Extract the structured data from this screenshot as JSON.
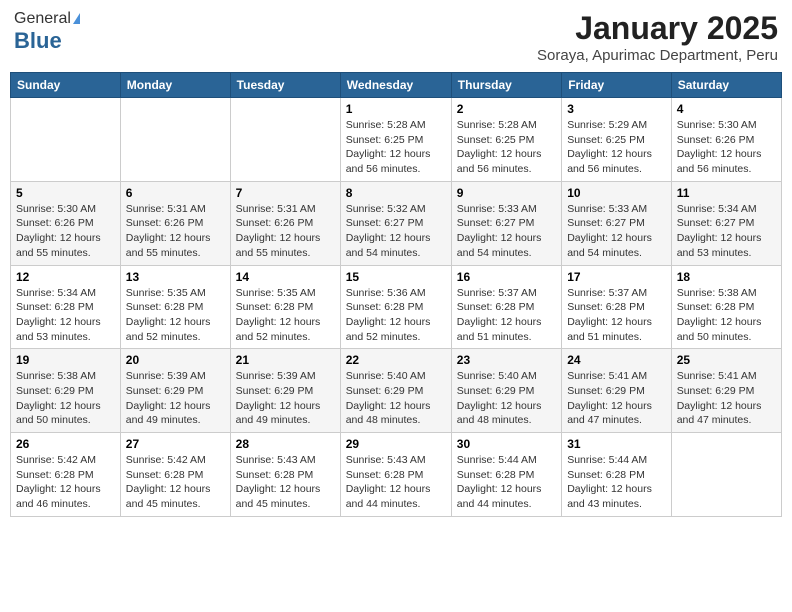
{
  "header": {
    "logo_line1": "General",
    "logo_line2": "Blue",
    "month_title": "January 2025",
    "subtitle": "Soraya, Apurimac Department, Peru"
  },
  "weekdays": [
    "Sunday",
    "Monday",
    "Tuesday",
    "Wednesday",
    "Thursday",
    "Friday",
    "Saturday"
  ],
  "weeks": [
    [
      {
        "day": "",
        "sunrise": "",
        "sunset": "",
        "daylight": ""
      },
      {
        "day": "",
        "sunrise": "",
        "sunset": "",
        "daylight": ""
      },
      {
        "day": "",
        "sunrise": "",
        "sunset": "",
        "daylight": ""
      },
      {
        "day": "1",
        "sunrise": "Sunrise: 5:28 AM",
        "sunset": "Sunset: 6:25 PM",
        "daylight": "Daylight: 12 hours and 56 minutes."
      },
      {
        "day": "2",
        "sunrise": "Sunrise: 5:28 AM",
        "sunset": "Sunset: 6:25 PM",
        "daylight": "Daylight: 12 hours and 56 minutes."
      },
      {
        "day": "3",
        "sunrise": "Sunrise: 5:29 AM",
        "sunset": "Sunset: 6:25 PM",
        "daylight": "Daylight: 12 hours and 56 minutes."
      },
      {
        "day": "4",
        "sunrise": "Sunrise: 5:30 AM",
        "sunset": "Sunset: 6:26 PM",
        "daylight": "Daylight: 12 hours and 56 minutes."
      }
    ],
    [
      {
        "day": "5",
        "sunrise": "Sunrise: 5:30 AM",
        "sunset": "Sunset: 6:26 PM",
        "daylight": "Daylight: 12 hours and 55 minutes."
      },
      {
        "day": "6",
        "sunrise": "Sunrise: 5:31 AM",
        "sunset": "Sunset: 6:26 PM",
        "daylight": "Daylight: 12 hours and 55 minutes."
      },
      {
        "day": "7",
        "sunrise": "Sunrise: 5:31 AM",
        "sunset": "Sunset: 6:26 PM",
        "daylight": "Daylight: 12 hours and 55 minutes."
      },
      {
        "day": "8",
        "sunrise": "Sunrise: 5:32 AM",
        "sunset": "Sunset: 6:27 PM",
        "daylight": "Daylight: 12 hours and 54 minutes."
      },
      {
        "day": "9",
        "sunrise": "Sunrise: 5:33 AM",
        "sunset": "Sunset: 6:27 PM",
        "daylight": "Daylight: 12 hours and 54 minutes."
      },
      {
        "day": "10",
        "sunrise": "Sunrise: 5:33 AM",
        "sunset": "Sunset: 6:27 PM",
        "daylight": "Daylight: 12 hours and 54 minutes."
      },
      {
        "day": "11",
        "sunrise": "Sunrise: 5:34 AM",
        "sunset": "Sunset: 6:27 PM",
        "daylight": "Daylight: 12 hours and 53 minutes."
      }
    ],
    [
      {
        "day": "12",
        "sunrise": "Sunrise: 5:34 AM",
        "sunset": "Sunset: 6:28 PM",
        "daylight": "Daylight: 12 hours and 53 minutes."
      },
      {
        "day": "13",
        "sunrise": "Sunrise: 5:35 AM",
        "sunset": "Sunset: 6:28 PM",
        "daylight": "Daylight: 12 hours and 52 minutes."
      },
      {
        "day": "14",
        "sunrise": "Sunrise: 5:35 AM",
        "sunset": "Sunset: 6:28 PM",
        "daylight": "Daylight: 12 hours and 52 minutes."
      },
      {
        "day": "15",
        "sunrise": "Sunrise: 5:36 AM",
        "sunset": "Sunset: 6:28 PM",
        "daylight": "Daylight: 12 hours and 52 minutes."
      },
      {
        "day": "16",
        "sunrise": "Sunrise: 5:37 AM",
        "sunset": "Sunset: 6:28 PM",
        "daylight": "Daylight: 12 hours and 51 minutes."
      },
      {
        "day": "17",
        "sunrise": "Sunrise: 5:37 AM",
        "sunset": "Sunset: 6:28 PM",
        "daylight": "Daylight: 12 hours and 51 minutes."
      },
      {
        "day": "18",
        "sunrise": "Sunrise: 5:38 AM",
        "sunset": "Sunset: 6:28 PM",
        "daylight": "Daylight: 12 hours and 50 minutes."
      }
    ],
    [
      {
        "day": "19",
        "sunrise": "Sunrise: 5:38 AM",
        "sunset": "Sunset: 6:29 PM",
        "daylight": "Daylight: 12 hours and 50 minutes."
      },
      {
        "day": "20",
        "sunrise": "Sunrise: 5:39 AM",
        "sunset": "Sunset: 6:29 PM",
        "daylight": "Daylight: 12 hours and 49 minutes."
      },
      {
        "day": "21",
        "sunrise": "Sunrise: 5:39 AM",
        "sunset": "Sunset: 6:29 PM",
        "daylight": "Daylight: 12 hours and 49 minutes."
      },
      {
        "day": "22",
        "sunrise": "Sunrise: 5:40 AM",
        "sunset": "Sunset: 6:29 PM",
        "daylight": "Daylight: 12 hours and 48 minutes."
      },
      {
        "day": "23",
        "sunrise": "Sunrise: 5:40 AM",
        "sunset": "Sunset: 6:29 PM",
        "daylight": "Daylight: 12 hours and 48 minutes."
      },
      {
        "day": "24",
        "sunrise": "Sunrise: 5:41 AM",
        "sunset": "Sunset: 6:29 PM",
        "daylight": "Daylight: 12 hours and 47 minutes."
      },
      {
        "day": "25",
        "sunrise": "Sunrise: 5:41 AM",
        "sunset": "Sunset: 6:29 PM",
        "daylight": "Daylight: 12 hours and 47 minutes."
      }
    ],
    [
      {
        "day": "26",
        "sunrise": "Sunrise: 5:42 AM",
        "sunset": "Sunset: 6:28 PM",
        "daylight": "Daylight: 12 hours and 46 minutes."
      },
      {
        "day": "27",
        "sunrise": "Sunrise: 5:42 AM",
        "sunset": "Sunset: 6:28 PM",
        "daylight": "Daylight: 12 hours and 45 minutes."
      },
      {
        "day": "28",
        "sunrise": "Sunrise: 5:43 AM",
        "sunset": "Sunset: 6:28 PM",
        "daylight": "Daylight: 12 hours and 45 minutes."
      },
      {
        "day": "29",
        "sunrise": "Sunrise: 5:43 AM",
        "sunset": "Sunset: 6:28 PM",
        "daylight": "Daylight: 12 hours and 44 minutes."
      },
      {
        "day": "30",
        "sunrise": "Sunrise: 5:44 AM",
        "sunset": "Sunset: 6:28 PM",
        "daylight": "Daylight: 12 hours and 44 minutes."
      },
      {
        "day": "31",
        "sunrise": "Sunrise: 5:44 AM",
        "sunset": "Sunset: 6:28 PM",
        "daylight": "Daylight: 12 hours and 43 minutes."
      },
      {
        "day": "",
        "sunrise": "",
        "sunset": "",
        "daylight": ""
      }
    ]
  ]
}
